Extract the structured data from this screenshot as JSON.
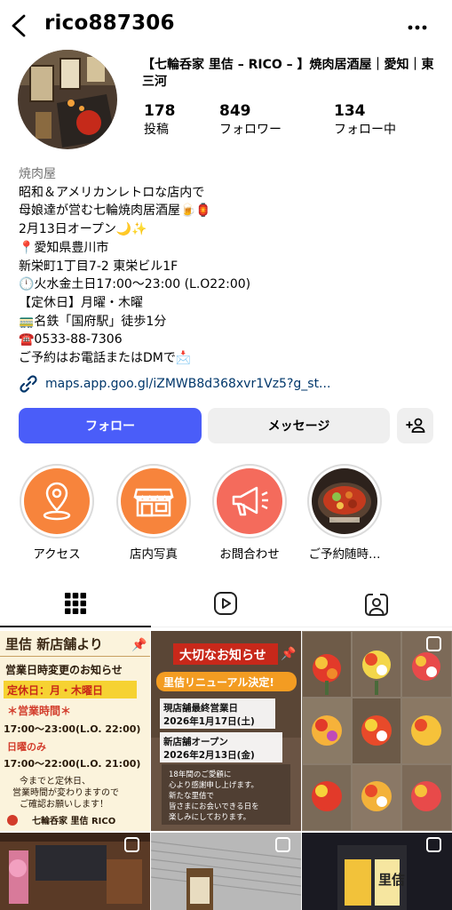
{
  "header": {
    "username": "rico887306",
    "back_icon": "chevron-left-icon",
    "more_icon": "more-dots-icon"
  },
  "profile": {
    "display_name": "【七輪呑家 里佶 – RICO – 】焼肉居酒屋｜愛知｜東三河",
    "stats": [
      {
        "count": "178",
        "label": "投稿"
      },
      {
        "count": "849",
        "label": "フォロワー"
      },
      {
        "count": "134",
        "label": "フォロー中"
      }
    ]
  },
  "bio": {
    "category": "焼肉屋",
    "lines": [
      "昭和＆アメリカンレトロな店内で",
      "母娘達が営む七輪焼肉居酒屋🍺🏮",
      "2月13日オープン🌙✨",
      "📍愛知県豊川市",
      "新栄町1丁目7-2 東栄ビル1F",
      "🕛火水金土日17:00～23:00 (L.O22:00)",
      "【定休日】月曜・木曜",
      "🚃名鉄「国府駅」徒歩1分",
      "☎️0533-88-7306",
      "ご予約はお電話またはDMで📩"
    ],
    "link": "maps.app.goo.gl/iZMWB8d368xvr1Vz5?g_st..."
  },
  "actions": {
    "follow": "フォロー",
    "message": "メッセージ"
  },
  "highlights": [
    {
      "label": "アクセス",
      "icon": "map-pin-icon",
      "color": "#f7843c"
    },
    {
      "label": "店内写真",
      "icon": "storefront-icon",
      "color": "#f7843c"
    },
    {
      "label": "お問合わせ",
      "icon": "megaphone-icon",
      "color": "#f46b5c"
    },
    {
      "label": "ご予約随時…",
      "icon": "food-photo",
      "color": "#3c2a22"
    }
  ],
  "posts": {
    "p1": {
      "title": "里佶 新店舗より",
      "notice": "営業日時変更のお知らせ",
      "closed": "定休日：月・木曜日",
      "hours_title": "＊営業時間＊",
      "hours": "17:00～23:00(L.O. 22:00)",
      "sunday": "日曜のみ",
      "sunday_hours": "17:00～22:00(L.O. 21:00)",
      "note1": "今までと定休日、",
      "note2": "営業時間が変わりますので",
      "note3": "ご確認お願いします！",
      "shop": "七輪呑家 里佶 RICO"
    },
    "p2": {
      "title": "大切なお知らせ",
      "banner": "里佶リニューアル決定!",
      "last1": "現店舗最終営業日",
      "last2": "2026年1月17日(土)",
      "open1": "新店舗オープン",
      "open2": "2026年2月13日(金)",
      "body1": "18年間のご愛顧に",
      "body2": "心より感謝申し上げます。",
      "body3": "新たな里佶で",
      "body4": "皆さまにお会いできる日を",
      "body5": "楽しみにしております。"
    },
    "p6_sign": "里佶"
  },
  "colors": {
    "accent": "#4a5df9",
    "link": "#00376b",
    "secondary_btn": "#efefef"
  }
}
